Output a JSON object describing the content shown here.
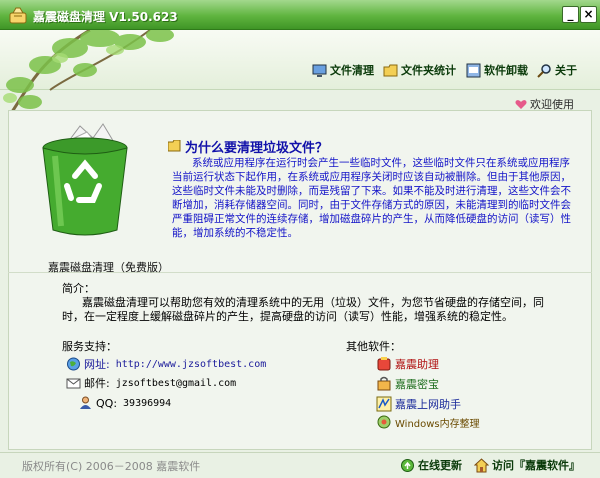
{
  "window": {
    "title": "嘉震磁盘清理  V1.50.623",
    "minimize_label": "_",
    "close_label": "×"
  },
  "nav": {
    "files": "文件清理",
    "folders": "文件夹统计",
    "uninstall": "软件卸载",
    "about": "关于"
  },
  "welcome": "欢迎使用",
  "question": {
    "title": "为什么要清理垃圾文件？",
    "body": "系统或应用程序在运行时会产生一些临时文件，这些临时文件只在系统或应用程序当前运行状态下起作用，在系统或应用程序关闭时应该自动被删除。但由于其他原因，这些临时文件未能及时删除，而是残留了下来。如果不能及时进行清理，这些文件会不断增加，消耗存储器空间。同时，由于文件存储方式的原因，未能清理到的临时文件会严重阻碍正常文件的连续存储，增加磁盘碎片的产生，从而降低硬盘的访问（读写）性能，增加系统的不稳定性。"
  },
  "product": {
    "group_title": "嘉震磁盘清理（免费版）",
    "intro_label": "简介：",
    "intro_body": "嘉震磁盘清理可以帮助您有效的清理系统中的无用（垃圾）文件，为您节省硬盘的存储空间，同时，在一定程度上缓解磁盘碎片的产生，提高硬盘的访问（读写）性能，增强系统的稳定性。"
  },
  "support": {
    "label": "服务支持：",
    "web_label": "网址:",
    "web_value": "http://www.jzsoftbest.com",
    "mail_label": "邮件:",
    "mail_value": "jzsoftbest@gmail.com",
    "qq_label": "QQ:",
    "qq_value": "39396994"
  },
  "other_software": {
    "label": "其他软件：",
    "items": [
      "嘉震助理",
      "嘉震密宝",
      "嘉震上网助手",
      "Windows内存整理"
    ]
  },
  "footer": {
    "copyright": "版权所有(C) 2006－2008 嘉震软件",
    "update": "在线更新",
    "visit": "访问『嘉震软件』"
  },
  "colors": {
    "titlebar": "#5fb43f",
    "question_text": "#1414c8",
    "accent_red": "#b01010"
  }
}
